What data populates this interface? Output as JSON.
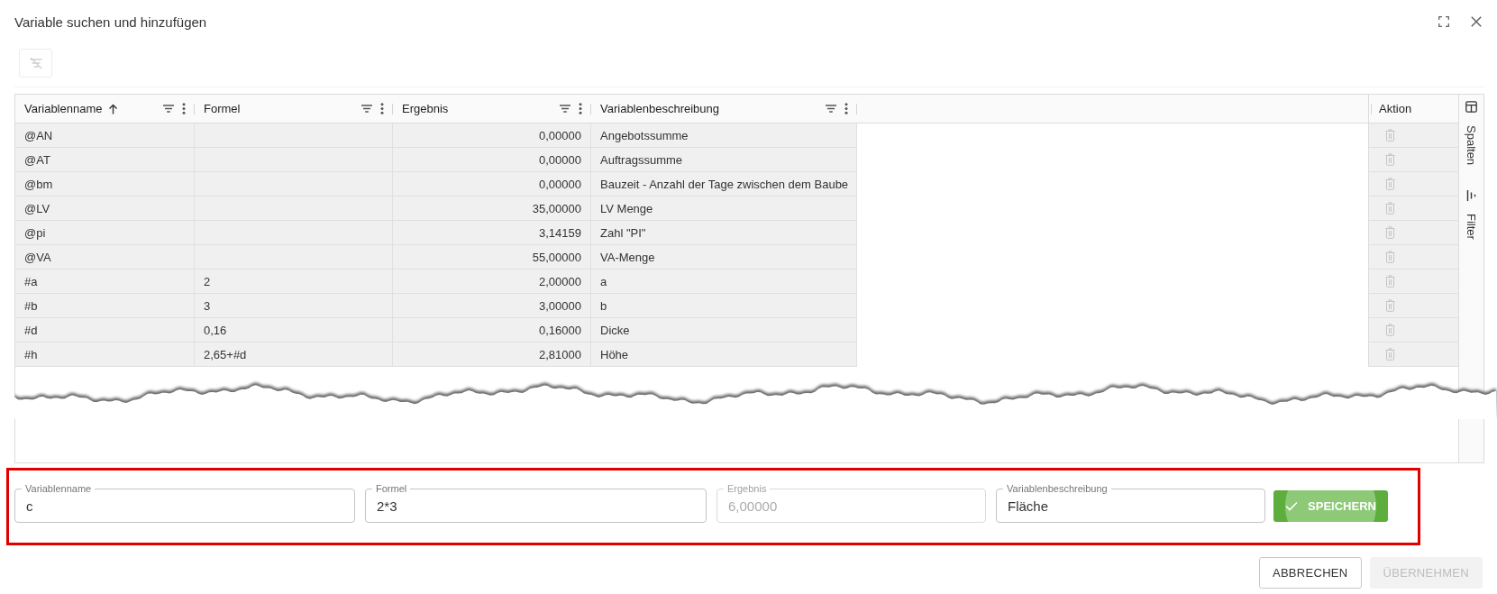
{
  "dialog": {
    "title": "Variable suchen und hinzufügen"
  },
  "toolbar": {
    "clear_filters_button": {
      "disabled": true
    }
  },
  "table": {
    "columns": [
      {
        "label": "Variablenname",
        "sorted": true
      },
      {
        "label": "Formel",
        "sorted": false
      },
      {
        "label": "Ergebnis",
        "sorted": false
      },
      {
        "label": "Variablenbeschreibung",
        "sorted": false
      }
    ],
    "action_column": {
      "label": "Aktion"
    },
    "rows": [
      {
        "name": "@AN",
        "result": "0,00000",
        "description": "Angebotssumme"
      },
      {
        "name": "@AT",
        "result": "0,00000",
        "description": "Auftragssumme"
      },
      {
        "name": "@bm",
        "result": "0,00000",
        "description": "Bauzeit - Anzahl der Tage zwischen dem Baube"
      },
      {
        "name": "@LV",
        "result": "35,00000",
        "description": "LV Menge"
      },
      {
        "name": "@pi",
        "result": "3,14159",
        "description": "Zahl \"PI\""
      },
      {
        "name": "@VA",
        "result": "55,00000",
        "description": "VA-Menge"
      },
      {
        "name": "#a",
        "formula": "2",
        "result": "2,00000",
        "description": "a"
      },
      {
        "name": "#b",
        "formula": "3",
        "result": "3,00000",
        "description": "b"
      },
      {
        "name": "#d",
        "formula": "0,16",
        "result": "0,16000",
        "description": "Dicke"
      },
      {
        "name": "#h",
        "formula": "2,65+#d",
        "result": "2,81000",
        "description": "Höhe"
      }
    ],
    "side_tabs": [
      {
        "label": "Spalten",
        "kind": "columns",
        "selected": false
      },
      {
        "label": "Filter",
        "kind": "filter",
        "selected": false
      }
    ]
  },
  "form": {
    "highlighted": true,
    "fields": [
      {
        "label": "Variablenname",
        "value": "c",
        "disabled": false
      },
      {
        "label": "Formel",
        "value": "2*3",
        "disabled": false
      },
      {
        "label": "Ergebnis",
        "value": "6,00000",
        "disabled": true
      },
      {
        "label": "Variablenbeschreibung",
        "value": "Fläche",
        "disabled": false
      }
    ],
    "save_button": {
      "label": "SPEICHERN"
    }
  },
  "footer": {
    "buttons": [
      {
        "label": "ABBRECHEN",
        "disabled": false
      },
      {
        "label": "ÜBERNEHMEN",
        "disabled": true
      }
    ]
  }
}
